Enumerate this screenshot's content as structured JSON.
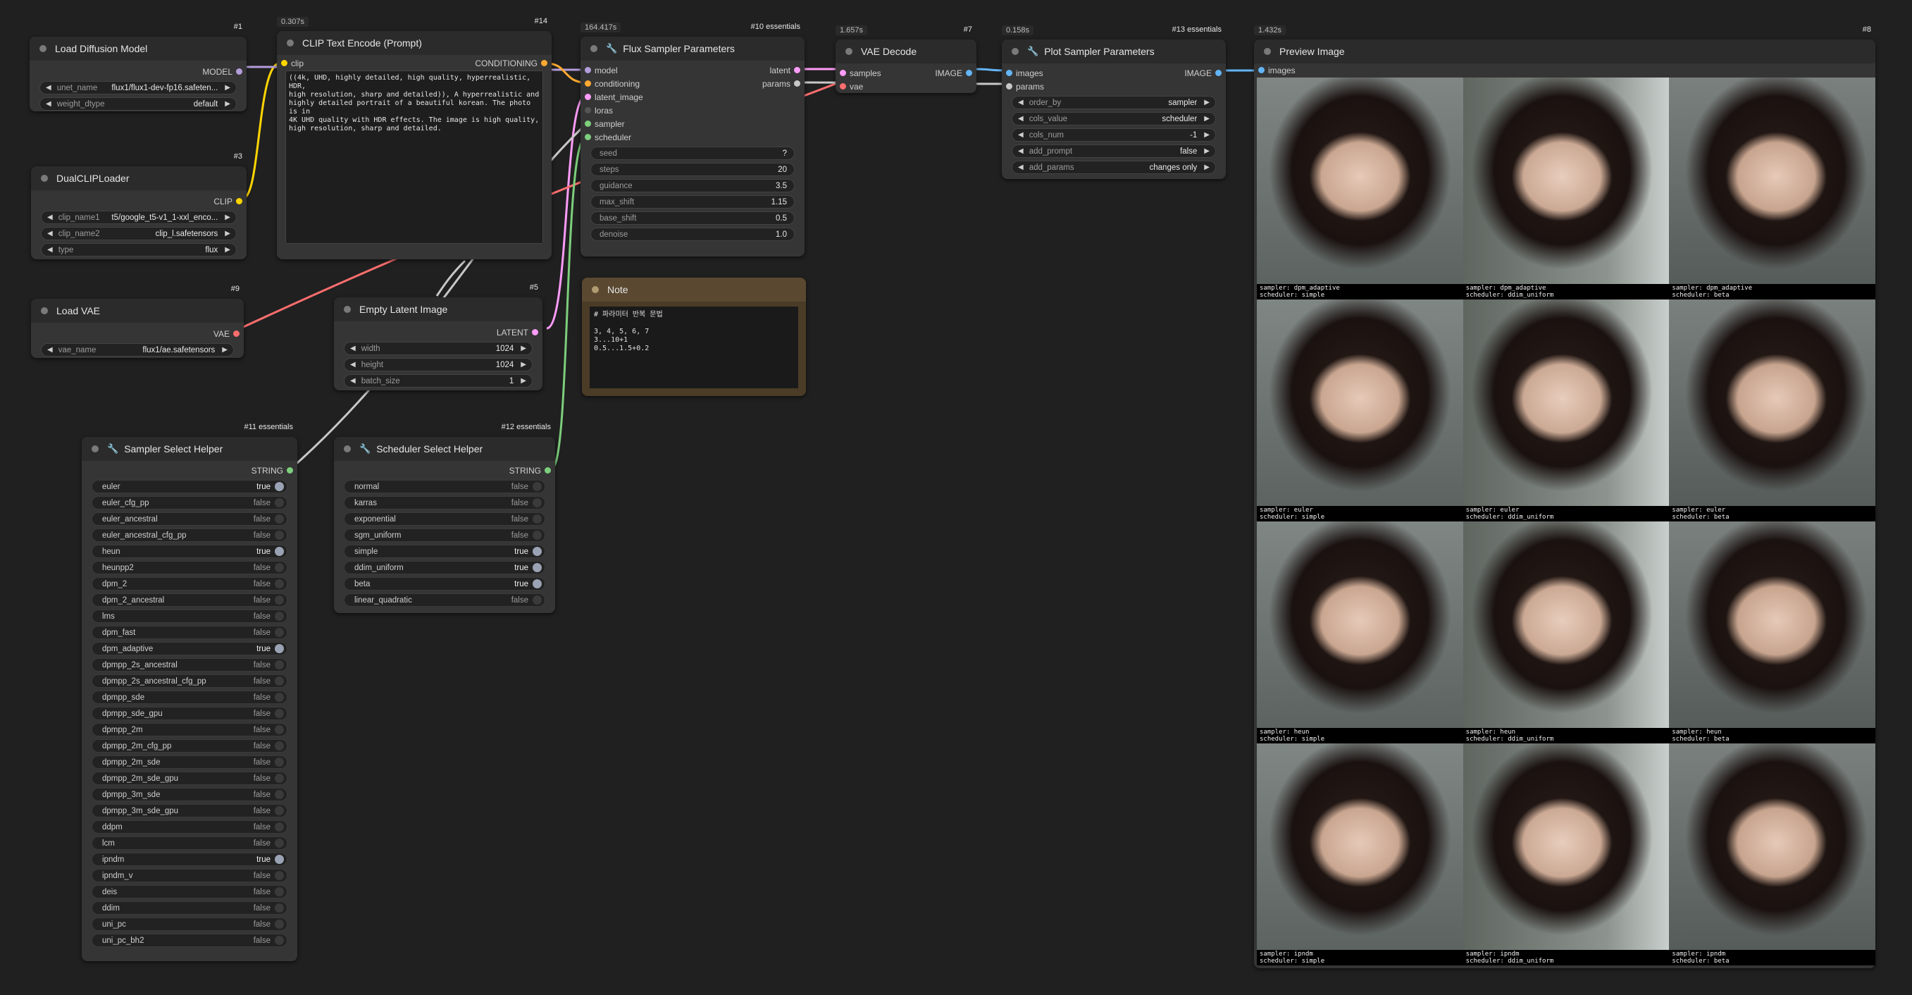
{
  "nodes": {
    "load_diffusion": {
      "id": "#1",
      "title": "Load Diffusion Model",
      "output": "MODEL",
      "widgets": [
        {
          "name": "unet_name",
          "value": "flux1/flux1-dev-fp16.safeten..."
        },
        {
          "name": "weight_dtype",
          "value": "default"
        }
      ]
    },
    "dual_clip": {
      "id": "#3",
      "title": "DualCLIPLoader",
      "output": "CLIP",
      "widgets": [
        {
          "name": "clip_name1",
          "value": "t5/google_t5-v1_1-xxl_enco..."
        },
        {
          "name": "clip_name2",
          "value": "clip_l.safetensors"
        },
        {
          "name": "type",
          "value": "flux"
        }
      ]
    },
    "load_vae": {
      "id": "#9",
      "title": "Load VAE",
      "output": "VAE",
      "widgets": [
        {
          "name": "vae_name",
          "value": "flux1/ae.safetensors"
        }
      ]
    },
    "clip_text": {
      "id": "#14",
      "timing": "0.307s",
      "title": "CLIP Text Encode (Prompt)",
      "input": "clip",
      "output": "CONDITIONING",
      "text": "((4k, UHD, highly detailed, high quality, hyperrealistic, HDR,\nhigh resolution, sharp and detailed)), A hyperrealistic and\nhighly detailed portrait of a beautiful korean. The photo is in\n4K UHD quality with HDR effects. The image is high quality,\nhigh resolution, sharp and detailed."
    },
    "empty_latent": {
      "id": "#5",
      "title": "Empty Latent Image",
      "output": "LATENT",
      "widgets": [
        {
          "name": "width",
          "value": "1024"
        },
        {
          "name": "height",
          "value": "1024"
        },
        {
          "name": "batch_size",
          "value": "1"
        }
      ]
    },
    "flux_sampler": {
      "id": "#10 essentials",
      "timing": "164.417s",
      "title": "Flux Sampler Parameters",
      "inputs": [
        "model",
        "conditioning",
        "latent_image",
        "loras",
        "sampler",
        "scheduler"
      ],
      "outputs": [
        "latent",
        "params"
      ],
      "widgets": [
        {
          "name": "seed",
          "value": "?"
        },
        {
          "name": "steps",
          "value": "20"
        },
        {
          "name": "guidance",
          "value": "3.5"
        },
        {
          "name": "max_shift",
          "value": "1.15"
        },
        {
          "name": "base_shift",
          "value": "0.5"
        },
        {
          "name": "denoise",
          "value": "1.0"
        }
      ]
    },
    "note": {
      "title": "Note",
      "text": "# 파라미터 반복 문법\n\n3, 4, 5, 6, 7\n3...10+1\n0.5...1.5+0.2"
    },
    "vae_decode": {
      "id": "#7",
      "timing": "1.657s",
      "title": "VAE Decode",
      "inputs": [
        "samples",
        "vae"
      ],
      "output": "IMAGE"
    },
    "plot_sampler": {
      "id": "#13 essentials",
      "timing": "0.158s",
      "title": "Plot Sampler Parameters",
      "inputs": [
        "images",
        "params"
      ],
      "output": "IMAGE",
      "widgets": [
        {
          "name": "order_by",
          "value": "sampler"
        },
        {
          "name": "cols_value",
          "value": "scheduler"
        },
        {
          "name": "cols_num",
          "value": "-1"
        },
        {
          "name": "add_prompt",
          "value": "false"
        },
        {
          "name": "add_params",
          "value": "changes only"
        }
      ]
    },
    "preview": {
      "id": "#8",
      "timing": "1.432s",
      "title": "Preview Image",
      "input": "images",
      "captions": [
        {
          "sampler": "sampler: dpm_adaptive",
          "scheduler": "scheduler: simple"
        },
        {
          "sampler": "sampler: dpm_adaptive",
          "scheduler": "scheduler: ddim_uniform"
        },
        {
          "sampler": "sampler: dpm_adaptive",
          "scheduler": "scheduler: beta"
        },
        {
          "sampler": "sampler: euler",
          "scheduler": "scheduler: simple"
        },
        {
          "sampler": "sampler: euler",
          "scheduler": "scheduler: ddim_uniform"
        },
        {
          "sampler": "sampler: euler",
          "scheduler": "scheduler: beta"
        },
        {
          "sampler": "sampler: heun",
          "scheduler": "scheduler: simple"
        },
        {
          "sampler": "sampler: heun",
          "scheduler": "scheduler: ddim_uniform"
        },
        {
          "sampler": "sampler: heun",
          "scheduler": "scheduler: beta"
        },
        {
          "sampler": "sampler: ipndm",
          "scheduler": "scheduler: simple"
        },
        {
          "sampler": "sampler: ipndm",
          "scheduler": "scheduler: ddim_uniform"
        },
        {
          "sampler": "sampler: ipndm",
          "scheduler": "scheduler: beta"
        }
      ]
    },
    "sampler_helper": {
      "id": "#11 essentials",
      "title": "Sampler Select Helper",
      "output": "STRING",
      "toggles": [
        {
          "name": "euler",
          "value": "true"
        },
        {
          "name": "euler_cfg_pp",
          "value": "false"
        },
        {
          "name": "euler_ancestral",
          "value": "false"
        },
        {
          "name": "euler_ancestral_cfg_pp",
          "value": "false"
        },
        {
          "name": "heun",
          "value": "true"
        },
        {
          "name": "heunpp2",
          "value": "false"
        },
        {
          "name": "dpm_2",
          "value": "false"
        },
        {
          "name": "dpm_2_ancestral",
          "value": "false"
        },
        {
          "name": "lms",
          "value": "false"
        },
        {
          "name": "dpm_fast",
          "value": "false"
        },
        {
          "name": "dpm_adaptive",
          "value": "true"
        },
        {
          "name": "dpmpp_2s_ancestral",
          "value": "false"
        },
        {
          "name": "dpmpp_2s_ancestral_cfg_pp",
          "value": "false"
        },
        {
          "name": "dpmpp_sde",
          "value": "false"
        },
        {
          "name": "dpmpp_sde_gpu",
          "value": "false"
        },
        {
          "name": "dpmpp_2m",
          "value": "false"
        },
        {
          "name": "dpmpp_2m_cfg_pp",
          "value": "false"
        },
        {
          "name": "dpmpp_2m_sde",
          "value": "false"
        },
        {
          "name": "dpmpp_2m_sde_gpu",
          "value": "false"
        },
        {
          "name": "dpmpp_3m_sde",
          "value": "false"
        },
        {
          "name": "dpmpp_3m_sde_gpu",
          "value": "false"
        },
        {
          "name": "ddpm",
          "value": "false"
        },
        {
          "name": "lcm",
          "value": "false"
        },
        {
          "name": "ipndm",
          "value": "true"
        },
        {
          "name": "ipndm_v",
          "value": "false"
        },
        {
          "name": "deis",
          "value": "false"
        },
        {
          "name": "ddim",
          "value": "false"
        },
        {
          "name": "uni_pc",
          "value": "false"
        },
        {
          "name": "uni_pc_bh2",
          "value": "false"
        }
      ]
    },
    "scheduler_helper": {
      "id": "#12 essentials",
      "title": "Scheduler Select Helper",
      "output": "STRING",
      "toggles": [
        {
          "name": "normal",
          "value": "false"
        },
        {
          "name": "karras",
          "value": "false"
        },
        {
          "name": "exponential",
          "value": "false"
        },
        {
          "name": "sgm_uniform",
          "value": "false"
        },
        {
          "name": "simple",
          "value": "true"
        },
        {
          "name": "ddim_uniform",
          "value": "true"
        },
        {
          "name": "beta",
          "value": "true"
        },
        {
          "name": "linear_quadratic",
          "value": "false"
        }
      ]
    }
  },
  "colors": {
    "background": "#202020",
    "model": "#b39ddb",
    "clip": "#ffd500",
    "conditioning": "#ffa931",
    "latent": "#ff9cf9",
    "vae": "#ff6e6e",
    "image": "#64b5f6",
    "string": "#7ccf7c",
    "params": "#c8c8c8",
    "note_frame": "#6b5634"
  }
}
